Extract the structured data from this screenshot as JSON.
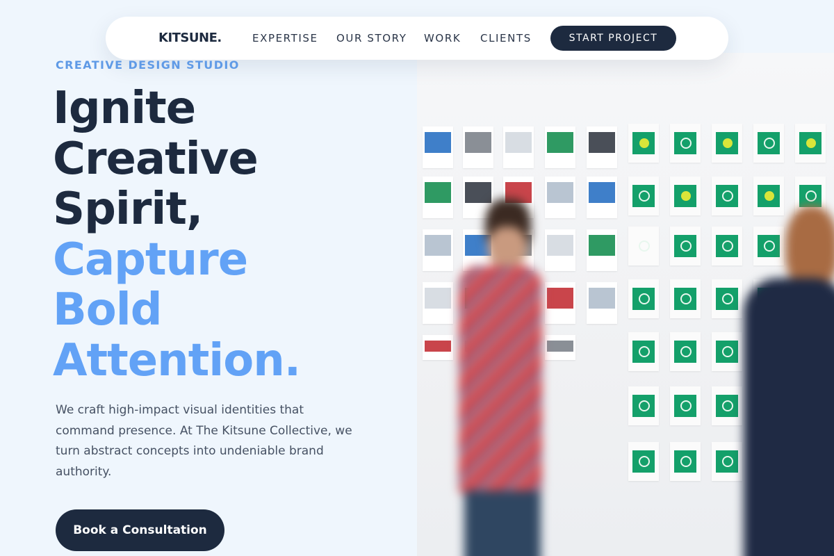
{
  "nav": {
    "brand": "KITSUNE.",
    "links": [
      "EXPERTISE",
      "OUR STORY",
      "WORK",
      "CLIENTS"
    ],
    "cta": "START PROJECT"
  },
  "hero": {
    "eyebrow": "CREATIVE DESIGN STUDIO",
    "headline_dark": [
      "Ignite",
      "Creative",
      "Spirit,"
    ],
    "headline_accent": [
      "Capture",
      "Bold",
      "Attention."
    ],
    "lede": "We craft high-impact visual identities that command presence. At The Kitsune Collective, we turn abstract concepts into undeniable brand authority.",
    "cta": "Book a Consultation"
  },
  "colors": {
    "background": "#eff6fd",
    "navy": "#1d2a3f",
    "accent_blue": "#62a2f6",
    "eyebrow_blue": "#5f9ae6",
    "logo_green": "#14a06a",
    "logo_yellow": "#d9e53a"
  },
  "image": {
    "subject": "people-walking-past-wall-of-brand-prints"
  }
}
